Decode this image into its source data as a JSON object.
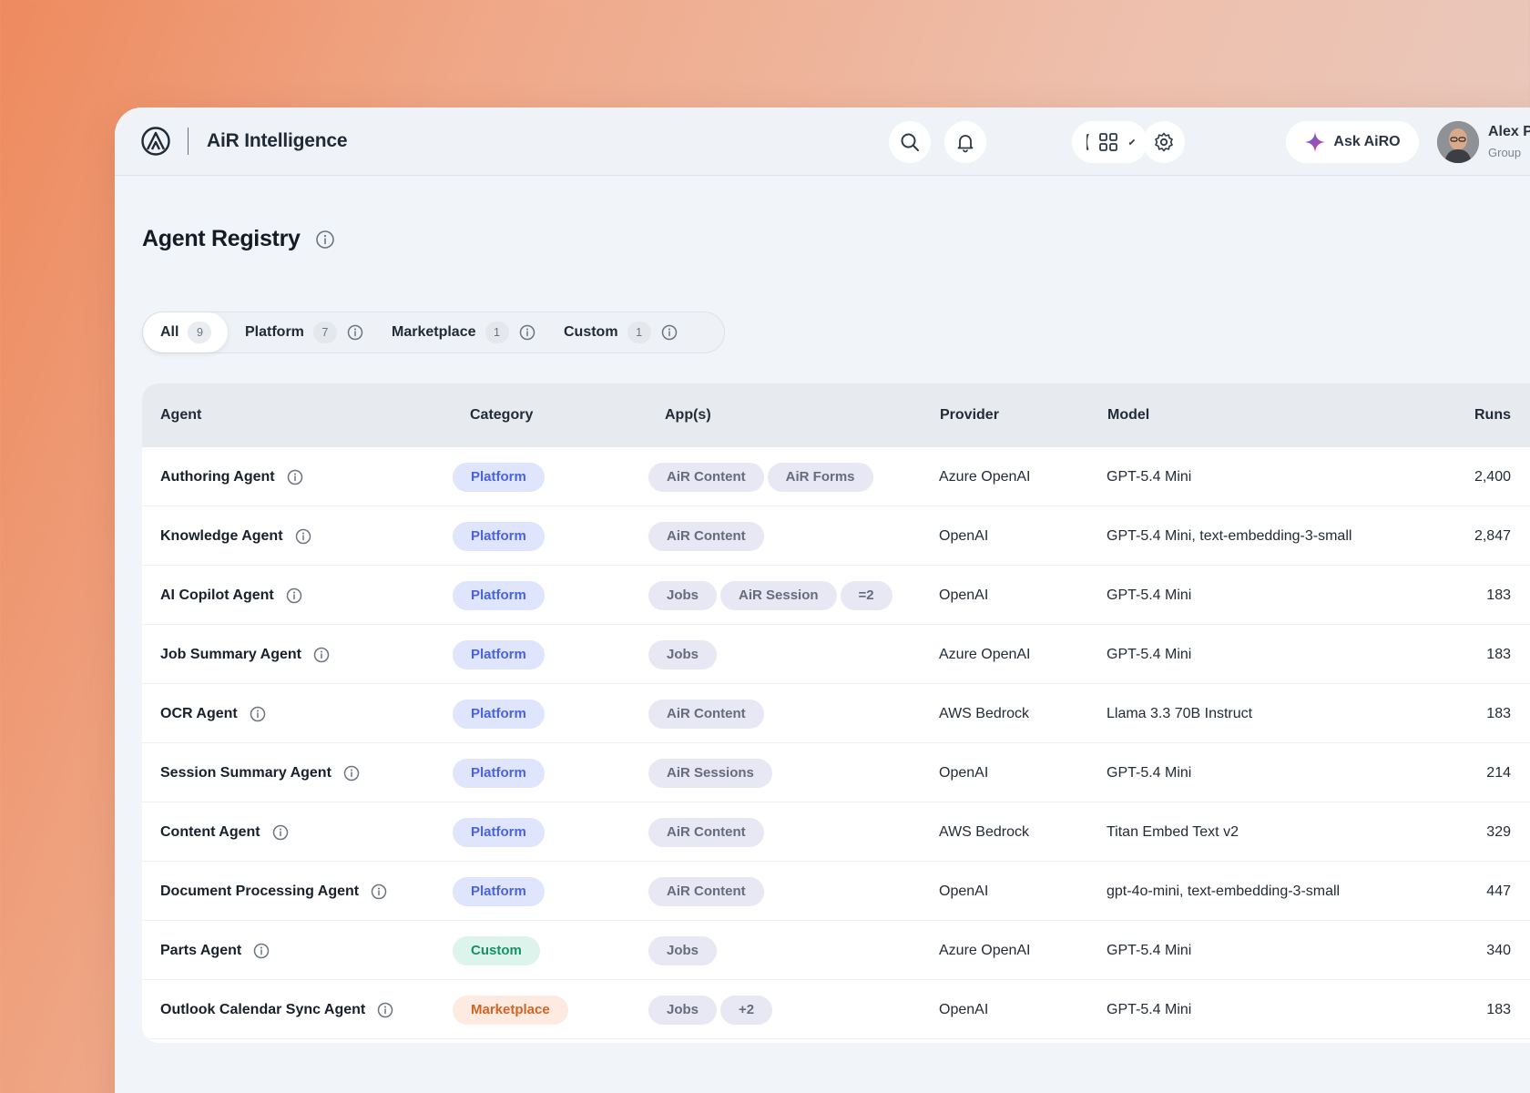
{
  "brand": {
    "name": "AiR Intelligence"
  },
  "topbar": {
    "ask_label": "Ask AiRO",
    "user_name": "Alex P",
    "user_role": "Group"
  },
  "page": {
    "title": "Agent Registry"
  },
  "tabs": [
    {
      "label": "All",
      "count": "9",
      "active": true
    },
    {
      "label": "Platform",
      "count": "7"
    },
    {
      "label": "Marketplace",
      "count": "1"
    },
    {
      "label": "Custom",
      "count": "1"
    }
  ],
  "table": {
    "columns": [
      "Agent",
      "Category",
      "App(s)",
      "Provider",
      "Model",
      "Runs"
    ],
    "rows": [
      {
        "agent": "Authoring Agent",
        "category": "Platform",
        "apps": [
          "AiR Content",
          "AiR Forms"
        ],
        "provider": "Azure OpenAI",
        "model": "GPT-5.4 Mini",
        "runs": "2,400"
      },
      {
        "agent": "Knowledge Agent",
        "category": "Platform",
        "apps": [
          "AiR Content"
        ],
        "provider": "OpenAI",
        "model": "GPT-5.4 Mini, text-embedding-3-small",
        "runs": "2,847"
      },
      {
        "agent": "AI Copilot Agent",
        "category": "Platform",
        "apps": [
          "Jobs",
          "AiR Session",
          "=2"
        ],
        "provider": "OpenAI",
        "model": "GPT-5.4 Mini",
        "runs": "183"
      },
      {
        "agent": "Job Summary Agent",
        "category": "Platform",
        "apps": [
          "Jobs"
        ],
        "provider": "Azure OpenAI",
        "model": "GPT-5.4 Mini",
        "runs": "183"
      },
      {
        "agent": "OCR Agent",
        "category": "Platform",
        "apps": [
          "AiR Content"
        ],
        "provider": "AWS Bedrock",
        "model": "Llama 3.3 70B Instruct",
        "runs": "183"
      },
      {
        "agent": "Session Summary Agent",
        "category": "Platform",
        "apps": [
          "AiR Sessions"
        ],
        "provider": "OpenAI",
        "model": "GPT-5.4 Mini",
        "runs": "214"
      },
      {
        "agent": "Content Agent",
        "category": "Platform",
        "apps": [
          "AiR Content"
        ],
        "provider": "AWS Bedrock",
        "model": "Titan Embed Text v2",
        "runs": "329"
      },
      {
        "agent": "Document Processing Agent",
        "category": "Platform",
        "apps": [
          "AiR Content"
        ],
        "provider": "OpenAI",
        "model": "gpt-4o-mini, text-embedding-3-small",
        "runs": "447"
      },
      {
        "agent": "Parts Agent",
        "category": "Custom",
        "apps": [
          "Jobs"
        ],
        "provider": "Azure OpenAI",
        "model": "GPT-5.4 Mini",
        "runs": "340"
      },
      {
        "agent": "Outlook Calendar Sync Agent",
        "category": "Marketplace",
        "apps": [
          "Jobs",
          "+2"
        ],
        "provider": "OpenAI",
        "model": "GPT-5.4 Mini",
        "runs": "183"
      }
    ]
  },
  "icons": {
    "logo": "air-logo-icon",
    "search": "search-icon",
    "notifications": "bell-icon",
    "bookmark": "bookmark-icon",
    "apps": "grid-icon",
    "settings": "gear-icon",
    "ask": "sparkle-icon",
    "info": "info-icon"
  },
  "colors": {
    "platform_bg": "#dfe5fd",
    "platform_fg": "#4a63dc",
    "custom_bg": "#dcf4ec",
    "custom_fg": "#17906a",
    "marketplace_bg": "#fdeae0",
    "marketplace_fg": "#d06424",
    "app_bg": "#e8e7f4",
    "app_fg": "#666c7e"
  }
}
